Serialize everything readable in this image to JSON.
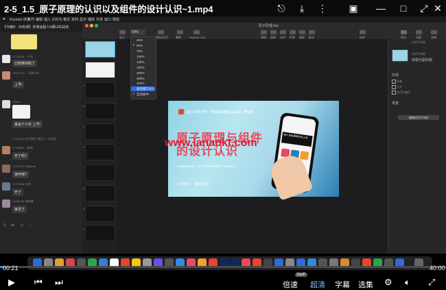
{
  "player": {
    "title": "2-5_1.5_原子原理的认识以及组件的设计认识~1.mp4",
    "time_current": "00:21",
    "time_total": "40:00",
    "progress_fraction": 0.009,
    "controls": {
      "speed": "倍速",
      "quality": "超清",
      "subtitles": "字幕",
      "selections": "选集",
      "swp": "SWP"
    }
  },
  "menubar": {
    "items": [
      "Keynote 讲演",
      "文件",
      "编辑",
      "插入",
      "幻灯片",
      "格式",
      "排列",
      "显示",
      "播放",
      "共享",
      "窗口",
      "帮助"
    ]
  },
  "chat": {
    "title": "【今晚8：30有课】虎课@超人6期UI实战班",
    "messages": [
      {
        "name": "17729431…小乌",
        "text": "已经离线啦了"
      },
      {
        "name": "14577123 …不要少年",
        "text": "上号!"
      },
      {
        "name": "16567…",
        "text": "来这个少年 上号!"
      },
      {
        "name": "17726891…安伟",
        "text": "开了吗?"
      },
      {
        "name": "17727321 Williame",
        "text": "连开呢?"
      },
      {
        "name": "17737891 小吗",
        "text": "开了"
      },
      {
        "name": "14695181 你的童",
        "text": "来早了"
      }
    ],
    "system_note": "\"1393459 你的我呀\" 撤回了一条消息"
  },
  "keynote": {
    "doc_title": "原子原理.key",
    "zoom_options": [
      "25%",
      "50%",
      "75%",
      "100%",
      "125%",
      "150%",
      "200%",
      "300%",
      "400%"
    ],
    "zoom_checked": "50%",
    "fit_options": [
      "适合窗口大小",
      "自动居中"
    ],
    "toolbar_labels": [
      "显示",
      "缩放",
      "添加幻灯片",
      "播放",
      "Keynote Live",
      "表格",
      "图表",
      "文本",
      "形状",
      "媒体",
      "批注",
      "协作",
      "格式",
      "动画",
      "文稿"
    ],
    "slide_numbers": [
      "1",
      "2",
      "3",
      "4",
      "5",
      "6",
      "7",
      "8",
      "9",
      "10"
    ],
    "inspector": {
      "section_title": "幻灯片布局",
      "layout_name": "标题与副标题",
      "appearance": "外观",
      "checkbox_title": "标题",
      "checkbox_body": "正文",
      "checkbox_number": "幻灯片编号",
      "background": "背景",
      "edit_layout_button": "编辑幻灯片布局"
    }
  },
  "slide": {
    "header": "超人的专业学 · 零基础UI精品实战班 · 第6期",
    "title_line1": "原子原理与组件",
    "title_line2": "的设计认识",
    "subtitle": "LESSON.05 — UI COMPONENT DESIGN",
    "teacher": "主讲老师：",
    "teacher_name": "酷狗不超人",
    "phone_text": "超人全栈课程共享上线"
  },
  "watermark": "www.lanaokt.com",
  "colors": {
    "accent_blue": "#2a8cff",
    "title_red": "#e84a5f",
    "watermark_red": "#e6172a"
  }
}
